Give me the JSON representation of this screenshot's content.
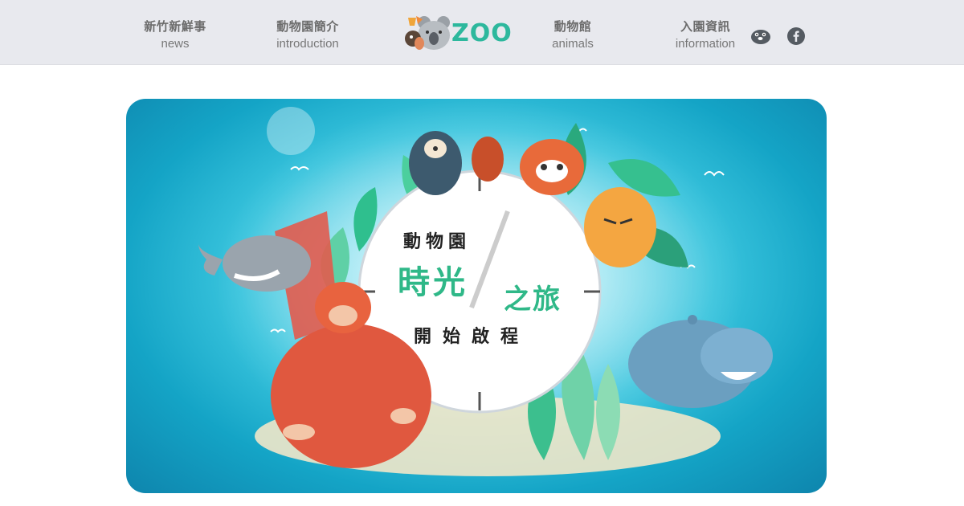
{
  "nav": {
    "items": [
      {
        "zh": "新竹新鮮事",
        "en": "news"
      },
      {
        "zh": "動物園簡介",
        "en": "introduction"
      },
      {
        "zh": "動物館",
        "en": "animals"
      },
      {
        "zh": "入園資訊",
        "en": "information"
      }
    ],
    "logo_text": "ZOO",
    "social": [
      {
        "icon": "otter-icon"
      },
      {
        "icon": "facebook-icon"
      }
    ]
  },
  "banner": {
    "title": {
      "line1": "動物園",
      "line2": "時光",
      "line3": "之旅",
      "line4": "開始啟程"
    }
  },
  "colors": {
    "nav_bg": "#e8e9ee",
    "brand_green": "#2db89d",
    "banner_blue": "#14a4c6",
    "title_green": "#2fb888"
  }
}
